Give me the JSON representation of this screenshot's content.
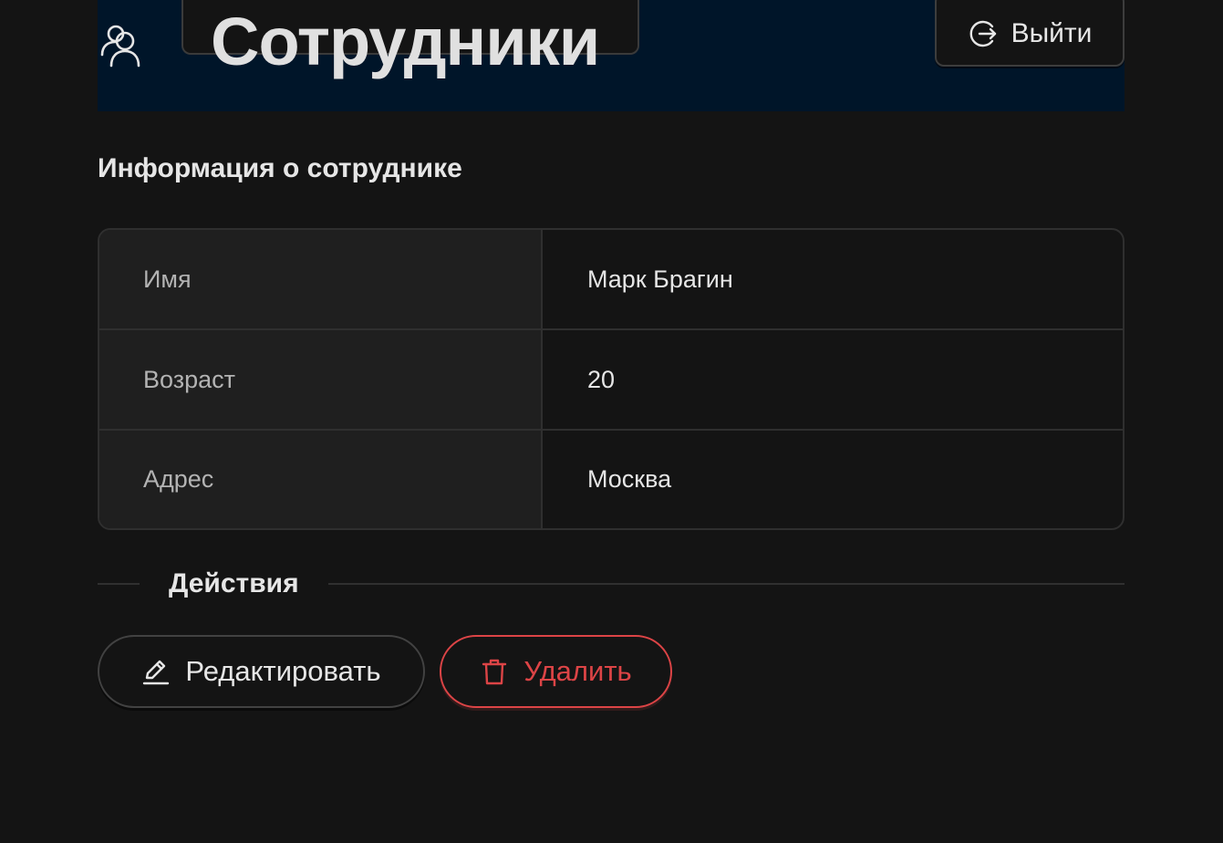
{
  "header": {
    "title": "Сотрудники",
    "icon": "team-icon",
    "logout_label": "Выйти",
    "logout_icon": "logout-icon",
    "background": "#001529"
  },
  "details": {
    "title": "Информация о сотруднике",
    "rows": [
      {
        "label": "Имя",
        "value": "Марк Брагин"
      },
      {
        "label": "Возраст",
        "value": "20"
      },
      {
        "label": "Адрес",
        "value": "Москва"
      }
    ]
  },
  "actions": {
    "divider_label": "Действия",
    "edit_label": "Редактировать",
    "edit_icon": "edit-icon",
    "delete_label": "Удалить",
    "delete_icon": "delete-icon",
    "danger_color": "#dc4446"
  }
}
